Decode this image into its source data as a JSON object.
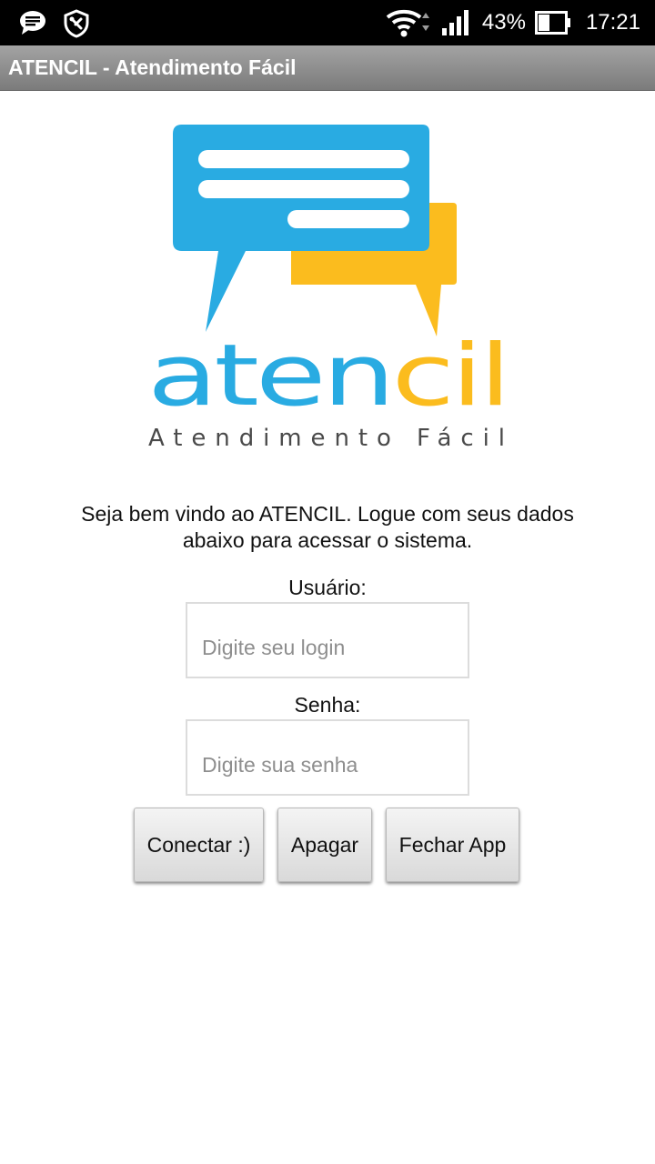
{
  "status_bar": {
    "notification_icons": [
      "message-icon",
      "shield-icon"
    ],
    "signal_icons": [
      "wifi-icon",
      "cell-signal-icon"
    ],
    "battery_percent": "43%",
    "battery_level": 0.43,
    "time": "17:21",
    "background_color": "#000000"
  },
  "app": {
    "title": "ATENCIL - Atendimento Fácil",
    "title_bar_color": "#8e8e8e"
  },
  "logo": {
    "wordmark_part1": "aten",
    "wordmark_part2": "cil",
    "tagline": "Atendimento Fácil",
    "blue": "#29abe2",
    "yellow": "#fbbc1e",
    "tagline_color": "#4a4a4a"
  },
  "welcome": {
    "line1": "Seja bem vindo ao ATENCIL. Logue com seus dados",
    "line2": "abaixo para acessar o sistema."
  },
  "form": {
    "user_label": "Usuário:",
    "user_value": "",
    "user_placeholder": "Digite seu login",
    "password_label": "Senha:",
    "password_value": "",
    "password_placeholder": "Digite sua senha"
  },
  "buttons": {
    "connect": "Conectar :)",
    "clear": "Apagar",
    "close": "Fechar App"
  }
}
